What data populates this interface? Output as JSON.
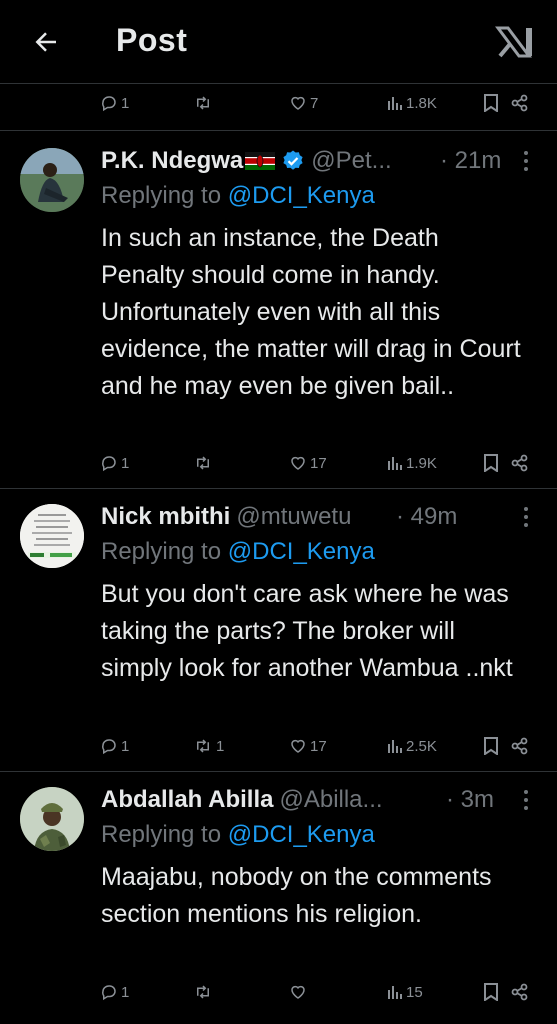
{
  "header": {
    "title": "Post"
  },
  "top_actions": {
    "replies": "1",
    "reposts": "",
    "likes": "7",
    "views": "1.8K"
  },
  "tweets": [
    {
      "name": "P.K. Ndegwa",
      "handle": "@Pet...",
      "time": "· 21m",
      "reply_prefix": "Replying to ",
      "reply_to": "@DCI_Kenya",
      "text": "In such an instance, the Death Penalty should come in handy. Unfortunately even with all this evidence, the matter will drag in Court and he may even be given bail..",
      "replies": "1",
      "reposts": "",
      "likes": "17",
      "views": "1.9K"
    },
    {
      "name": "Nick mbithi",
      "handle": "@mtuwetu",
      "time": "· 49m",
      "reply_prefix": "Replying to ",
      "reply_to": "@DCI_Kenya",
      "text": "But you don't care ask where he was taking the parts? The broker will simply look for another Wambua ..nkt",
      "replies": "1",
      "reposts": "1",
      "likes": "17",
      "views": "2.5K"
    },
    {
      "name": "Abdallah Abilla",
      "handle": "@Abilla...",
      "time": "· 3m",
      "reply_prefix": "Replying to ",
      "reply_to": "@DCI_Kenya",
      "text": "Maajabu, nobody on the comments section mentions his religion.",
      "replies": "1",
      "reposts": "",
      "likes": "",
      "views": "15"
    }
  ]
}
